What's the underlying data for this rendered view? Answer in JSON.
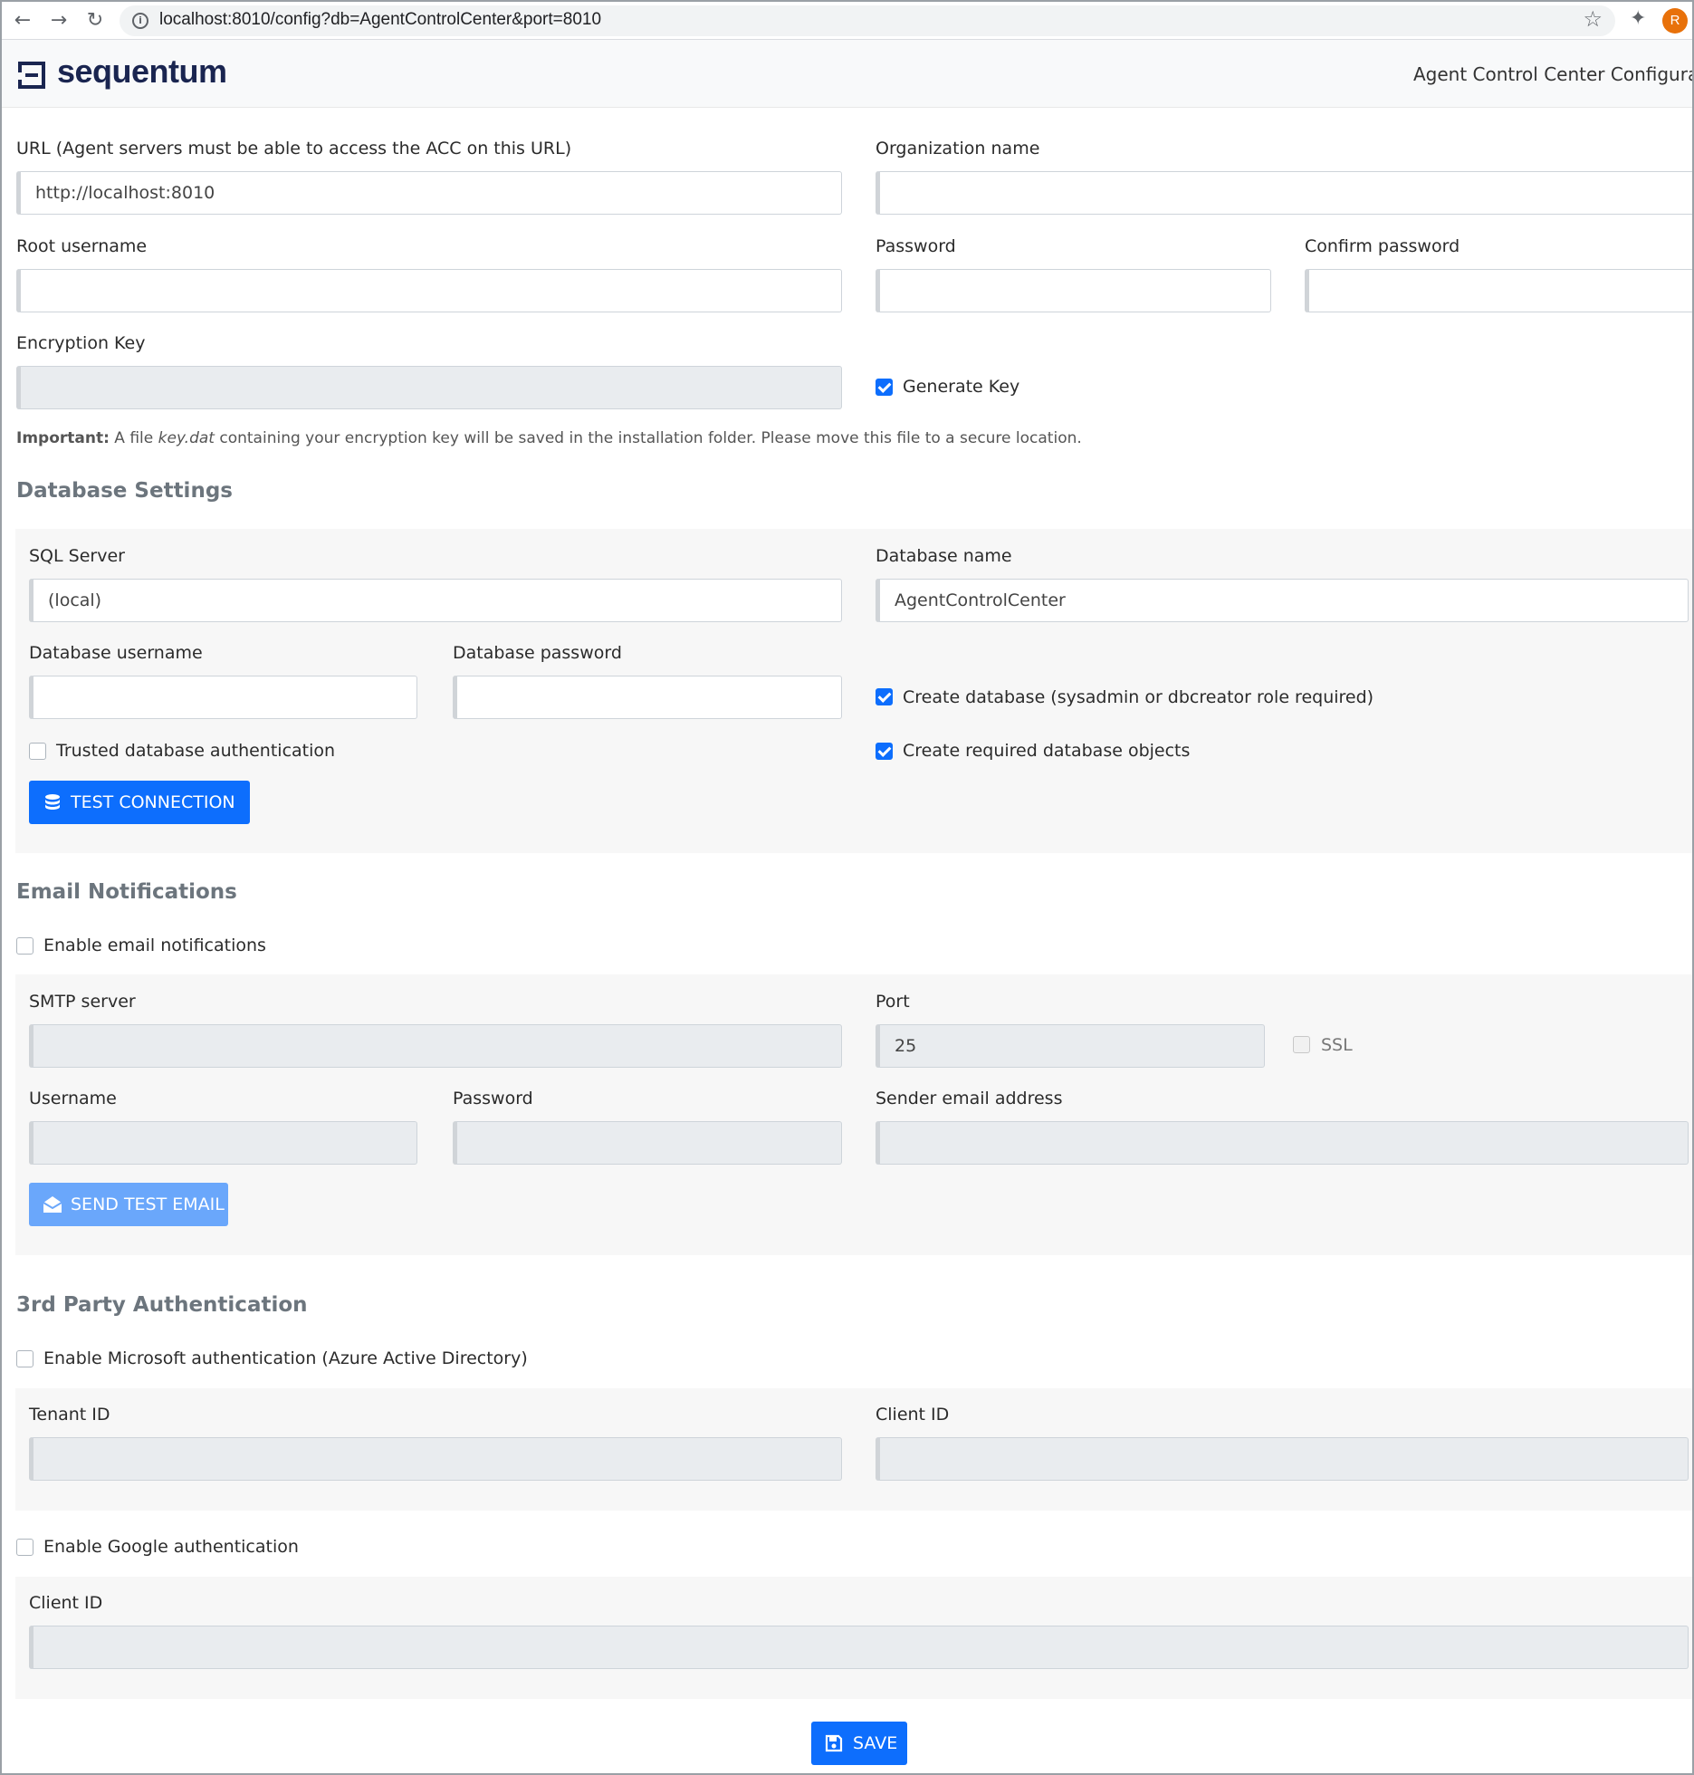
{
  "browser": {
    "url": "localhost:8010/config?db=AgentControlCenter&port=8010",
    "avatar_letter": "R",
    "icons": [
      "back-icon",
      "forward-icon",
      "reload-icon",
      "info-icon",
      "star-icon",
      "extensions-icon"
    ]
  },
  "header": {
    "logo_text": "sequentum",
    "title": "Agent Control Center Configuration"
  },
  "general": {
    "url_label": "URL (Agent servers must be able to access the ACC on this URL)",
    "url_value": "http://localhost:8010",
    "org_label": "Organization name",
    "org_value": "",
    "root_username_label": "Root username",
    "password_label": "Password",
    "confirm_password_label": "Confirm password",
    "encryption_key_label": "Encryption Key",
    "generate_key_label": "Generate Key",
    "generate_key_checked": true,
    "note_bold": "Important:",
    "note_pre": " A file ",
    "note_file": "key.dat",
    "note_post": " containing your encryption key will be saved in the installation folder. Please move this file to a secure location."
  },
  "database": {
    "title": "Database Settings",
    "sql_server_label": "SQL Server",
    "sql_server_value": "(local)",
    "db_name_label": "Database name",
    "db_name_value": "AgentControlCenter",
    "db_username_label": "Database username",
    "db_password_label": "Database password",
    "create_db_label": "Create database (sysadmin or dbcreator role required)",
    "trusted_auth_label": "Trusted database authentication",
    "create_objects_label": "Create required database objects",
    "test_connection_label": "TEST CONNECTION"
  },
  "email": {
    "title": "Email Notifications",
    "enable_label": "Enable email notifications",
    "smtp_label": "SMTP server",
    "port_label": "Port",
    "port_value": "25",
    "ssl_label": "SSL",
    "username_label": "Username",
    "password_label": "Password",
    "sender_label": "Sender email address",
    "send_test_label": "SEND TEST EMAIL"
  },
  "auth": {
    "title": "3rd Party Authentication",
    "microsoft_label": "Enable Microsoft authentication (Azure Active Directory)",
    "tenant_label": "Tenant ID",
    "ms_client_label": "Client ID",
    "google_label": "Enable Google authentication",
    "google_client_label": "Client ID"
  },
  "save_label": "SAVE",
  "colors": {
    "primary": "#0d6efd",
    "primary_disabled": "#6aa7fb",
    "logo": "#1a2550",
    "section_title": "#6c757d"
  }
}
